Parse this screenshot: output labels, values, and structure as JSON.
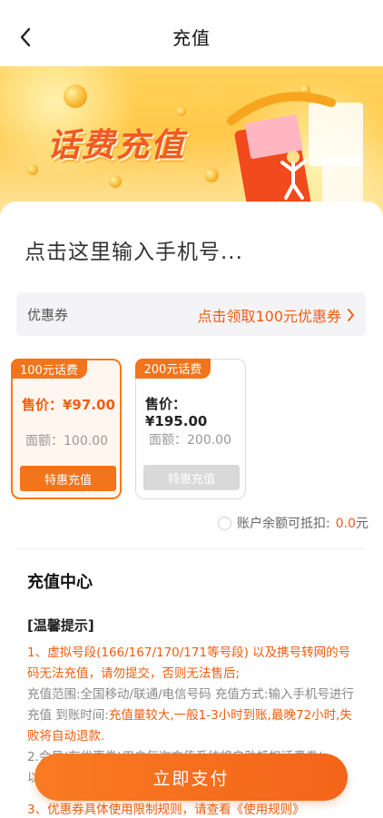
{
  "header": {
    "title": "充值",
    "back_icon": "chevron-left-icon"
  },
  "banner": {
    "text": "话费充值"
  },
  "phone_input": {
    "placeholder": "点击这里输入手机号..."
  },
  "coupon": {
    "label": "优惠券",
    "action": "点击领取100元优惠券",
    "action_icon": "chevron-right-icon"
  },
  "packages": [
    {
      "tag": "100元话费",
      "price": "售价：¥97.00",
      "face": "面额：100.00",
      "button": "特惠充值",
      "selected": true
    },
    {
      "tag": "200元话费",
      "price": "售价：¥195.00",
      "face": "面额：200.00",
      "button": "特惠充值",
      "selected": false
    }
  ],
  "balance": {
    "label": "账户余额可抵扣:",
    "value": "0.0",
    "unit": "元"
  },
  "recharge_center": {
    "title": "充值中心",
    "tips_title": "[温馨提示]"
  },
  "tips": {
    "t1": "1、虚拟号段(166/167/170/171等号段) 以及携号转网的号码无法充值，请勿提交，否则无法售后;",
    "t2a": "充值范围:全国移动/联通/电信号码 充值方式:输入手机号进行充值 到账时间:",
    "t2b": "充值量较大,一般1-3小时到账,最晚72小时,失败将自动退款.",
    "t3": "2.会员(有优惠券)用户每次充值系统将自助抵扣话费券(",
    "t3b": "以"
  },
  "pay_button": {
    "label": "立即支付"
  },
  "bottom_tip": "3、优惠券具体使用限制规则，请查看《使用规则》",
  "colors": {
    "accent": "#f25d0f",
    "button": "#f2741b",
    "disabled": "#d9d9d9"
  }
}
